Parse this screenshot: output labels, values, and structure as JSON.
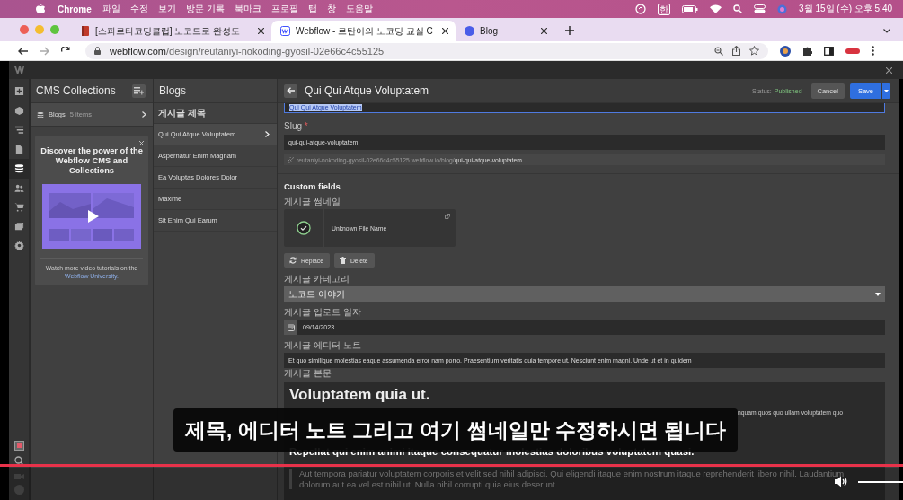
{
  "menu_bar": {
    "app": "Chrome",
    "items": [
      "파일",
      "수정",
      "보기",
      "방문 기록",
      "북마크",
      "프로필",
      "탭",
      "창",
      "도움말"
    ],
    "input_source": "한",
    "clock": "3월 15일 (수) 오후 5:40"
  },
  "browser": {
    "tabs": [
      {
        "title": "[스파르타코딩클럽] 노코드로 완성도",
        "selected": false,
        "kind": "book"
      },
      {
        "title": "Webflow - 르탄이의 노코딩 교실 C",
        "selected": true,
        "kind": "webflow"
      },
      {
        "title": "Blog",
        "selected": false,
        "kind": "dot"
      }
    ],
    "url_host": "webflow.com",
    "url_path": "/design/reutaniyi-nokoding-gyosil-02e66c4c55125"
  },
  "rail": [
    {
      "selected": false
    },
    {
      "selected": false
    },
    {
      "selected": false
    },
    {
      "selected": false
    },
    {
      "selected": true
    },
    {
      "selected": false
    },
    {
      "selected": false
    },
    {
      "selected": false
    },
    {
      "selected": false
    }
  ],
  "cms_panel": {
    "title": "CMS Collections",
    "collections": [
      {
        "name": "Blogs",
        "count": "5 items"
      }
    ],
    "promo": {
      "title": "Discover the power of the Webflow CMS and Collections",
      "caption": "Watch more video tutorials on the",
      "link": "Webflow University."
    }
  },
  "items_panel": {
    "title": "Blogs",
    "column": "게시글 제목",
    "items": [
      {
        "title": "Qui Qui Atque Voluptatem",
        "selected": true
      },
      {
        "title": "Aspernatur Enim Magnam",
        "selected": false
      },
      {
        "title": "Ea Voluptas Dolores Dolor",
        "selected": false
      },
      {
        "title": "Maxime",
        "selected": false
      },
      {
        "title": "Sit Enim Qui Earum",
        "selected": false
      }
    ]
  },
  "editor": {
    "title": "Qui Qui Atque Voluptatem",
    "status_label": "Status:",
    "status": "Published",
    "cancel": "Cancel",
    "save": "Save",
    "name_value": "Qui Qui Atque Voluptatem",
    "slug_label": "Slug",
    "required_mark": "*",
    "slug_value": "qui-qui-atque-voluptatem",
    "url_base": "reutaniyi-nokoding-gyosil-02e66c4c55125.webflow.io/blog/",
    "url_slug": "qui-qui-atque-voluptatem",
    "section": "Custom fields",
    "fields": [
      {
        "label": "게시글 썸네일",
        "file": "Unknown File Name",
        "replace": "Replace",
        "delete": "Delete"
      },
      {
        "kind": "select",
        "label": "게시글 카테고리",
        "value": "노코드 이야기"
      },
      {
        "kind": "date",
        "label": "게시글 업로드 일자",
        "value": "09/14/2023"
      },
      {
        "kind": "text",
        "label": "게시글 에디터 노트",
        "value": "Et quo similique molestias eaque assumenda error nam porro. Praesentium veritatis quia tempore ut. Nesciunt enim magni. Unde ut et in quidem"
      },
      {
        "kind": "rich",
        "label": "게시글 본문",
        "blocks": [
          {
            "kind": "h1",
            "text": "Voluptatem quia ut."
          },
          {
            "kind": "fragment",
            "text": "nquam quos quo ullam voluptatem quo"
          },
          {
            "kind": "h3",
            "text": "Repellat qui enim animi itaque consequatur molestias doloribus voluptatem quasi."
          },
          {
            "kind": "quote",
            "text": "Aut tempora pariatur voluptatem corporis et velit sed nihil adipisci. Qui eligendi itaque enim nostrum itaque reprehenderit libero nihil. Laudantium dolorum aut ea vel est nihil ut. Nulla nihil corrupti quia eius deserunt."
          }
        ]
      }
    ]
  },
  "video": {
    "subtitle": "제목, 에디터 노트 그리고 여기 썸네일만 수정하시면 됩니다",
    "progress": {
      "level": 1
    }
  }
}
